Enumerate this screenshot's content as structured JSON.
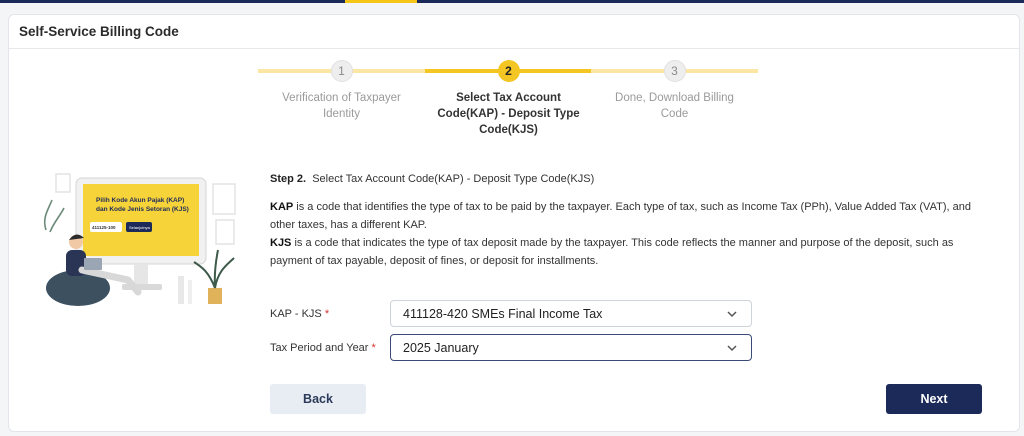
{
  "header": {
    "title": "Self-Service Billing Code"
  },
  "stepper": {
    "steps": [
      {
        "number": "1",
        "label": "Verification of Taxpayer Identity",
        "state": "done"
      },
      {
        "number": "2",
        "label": "Select Tax Account Code(KAP) - Deposit Type Code(KJS)",
        "state": "active"
      },
      {
        "number": "3",
        "label": "Done, Download Billing Code",
        "state": "pending"
      }
    ]
  },
  "illustration": {
    "screen_line1": "Pilih Kode Akun Pajak (KAP)",
    "screen_line2": "dan Kode Jenis Setoran (KJS)",
    "code": "411125-100",
    "button": "Selanjutnya"
  },
  "main": {
    "step_prefix": "Step 2.",
    "step_title": "Select Tax Account Code(KAP) - Deposit Type Code(KJS)",
    "kap_term": "KAP",
    "kap_desc": " is a code that identifies the type of tax to be paid by the taxpayer. Each type of tax, such as Income Tax (PPh), Value Added Tax (VAT), and other taxes, has a different KAP.",
    "kjs_term": "KJS",
    "kjs_desc": " is a code that indicates the type of tax deposit made by the taxpayer. This code reflects the manner and purpose of the deposit, such as payment of tax payable, deposit of fines, or deposit for installments."
  },
  "form": {
    "kap_label": "KAP - KJS",
    "kap_value": "411128-420 SMEs Final Income Tax",
    "period_label": "Tax Period and Year",
    "period_value": "2025 January",
    "required_mark": "*"
  },
  "actions": {
    "back": "Back",
    "next": "Next"
  },
  "colors": {
    "primary": "#1c2a5a",
    "accent": "#f3c623",
    "required": "#d0312d"
  }
}
